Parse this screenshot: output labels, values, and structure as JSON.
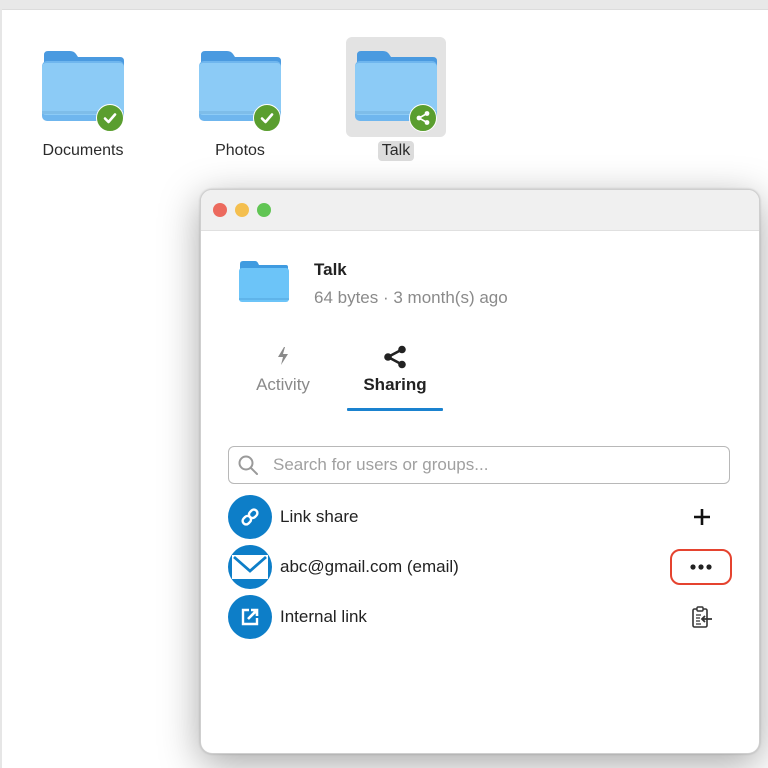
{
  "desktop": {
    "items": [
      {
        "label": "Documents",
        "badge": "sync-check",
        "selected": false
      },
      {
        "label": "Photos",
        "badge": "sync-check",
        "selected": false
      },
      {
        "label": "Talk",
        "badge": "shared",
        "selected": true
      }
    ]
  },
  "dialog": {
    "file": {
      "name": "Talk",
      "meta": "64 bytes · 3 month(s) ago"
    },
    "tabs": [
      {
        "label": "Activity",
        "icon": "lightning-icon",
        "active": false
      },
      {
        "label": "Sharing",
        "icon": "share-icon",
        "active": true
      }
    ],
    "search": {
      "placeholder": "Search for users or groups...",
      "value": ""
    },
    "shares": [
      {
        "label": "Link share",
        "icon": "link-icon",
        "action": "add",
        "action_icon": "plus-icon"
      },
      {
        "label": "abc@gmail.com (email)",
        "icon": "email-icon",
        "action": "more-options",
        "action_icon": "ellipsis-icon",
        "highlighted": true
      },
      {
        "label": "Internal link",
        "icon": "external-link-icon",
        "action": "copy",
        "action_icon": "clipboard-copy-icon"
      }
    ]
  },
  "colors": {
    "accent": "#0d7ec8",
    "tab_underline": "#1a82cf",
    "badge_green": "#5a9e2f",
    "highlight_red": "#e5432f",
    "folder_blue": "#7ec4f4"
  }
}
